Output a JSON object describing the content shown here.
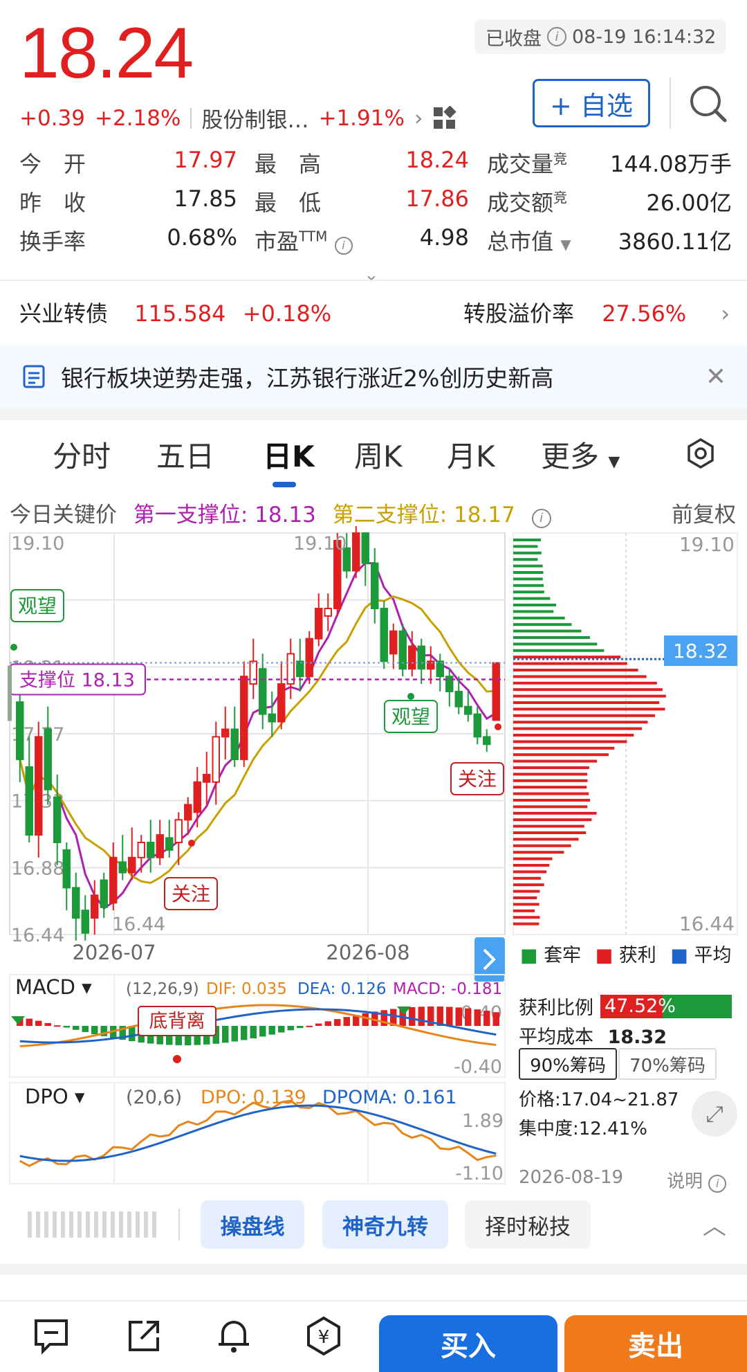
{
  "quote": {
    "price": "18.24",
    "change": "+0.39",
    "change_pct": "+2.18%",
    "sector_name": "股份制银…",
    "sector_pct": "+1.91%",
    "status": "已收盘",
    "datetime": "08-19 16:14:32",
    "fav_label": "+ 自选"
  },
  "stats": {
    "open_label": "今　开",
    "open": "17.97",
    "high_label": "最　高",
    "high": "18.24",
    "volume_label": "成交量",
    "volume_sup": "竞",
    "volume": "144.08万手",
    "prev_label": "昨　收",
    "prev": "17.85",
    "low_label": "最　低",
    "low": "17.86",
    "amount_label": "成交额",
    "amount_sup": "竞",
    "amount": "26.00亿",
    "turnover_label": "换手率",
    "turnover": "0.68%",
    "pe_label": "市盈",
    "pe_sup": "TTM",
    "pe": "4.98",
    "mcap_label": "总市值",
    "mcap": "3860.11亿"
  },
  "bond": {
    "name": "兴业转债",
    "price": "115.584",
    "pct": "+0.18%",
    "premium_label": "转股溢价率",
    "premium": "27.56%"
  },
  "news": {
    "text": "银行板块逆势走强，江苏银行涨近2%创历史新高"
  },
  "tabs": [
    "分时",
    "五日",
    "日K",
    "周K",
    "月K",
    "更多"
  ],
  "active_tab": "日K",
  "key_prices": {
    "label": "今日关键价",
    "support1": "第一支撑位: 18.13",
    "support2": "第二支撑位: 18.17",
    "adjust": "前复权"
  },
  "kchart_labels": {
    "y_ticks": [
      "19.10",
      "18.66",
      "18.21",
      "17.77",
      "17.33",
      "16.88",
      "16.44"
    ],
    "x_ticks": [
      "2026-07",
      "2026-08"
    ],
    "high_mark": "19.10",
    "low_mark": "16.44",
    "support_tag": "支撑位 18.13",
    "watch1": "观望",
    "watch2": "观望",
    "focus1": "关注",
    "focus2": "关注"
  },
  "chips": {
    "top": "19.10",
    "bottom": "16.44",
    "avg_tag": "18.32",
    "legend": [
      "套牢",
      "获利",
      "平均"
    ],
    "profit_label": "获利比例",
    "profit_pct": "47.52%",
    "avg_label": "平均成本",
    "avg_cost": "18.32",
    "btn90": "90%筹码",
    "btn70": "70%筹码",
    "range": "价格:17.04~21.87",
    "concentration": "集中度:12.41%",
    "date": "2026-08-19",
    "explain": "说明"
  },
  "macd": {
    "name": "MACD",
    "params": "(12,26,9)",
    "dif": "DIF: 0.035",
    "dea": "DEA: 0.126",
    "macd": "MACD: -0.181",
    "top": "0.40",
    "bottom": "-0.40",
    "tag": "底背离"
  },
  "dpo": {
    "name": "DPO",
    "params": "(20,6)",
    "dpo": "DPO: 0.139",
    "dpoma": "DPOMA: 0.161",
    "top": "1.89",
    "bottom": "-1.10"
  },
  "tools": [
    "操盘线",
    "神奇九转",
    "择时秘技"
  ],
  "footer": {
    "buy": "买入",
    "sell": "卖出"
  },
  "colors": {
    "up": "#e02020",
    "down": "#1c9a3a",
    "accent": "#1e63c8",
    "ma_purple": "#b020b0",
    "ma_gold": "#c8a000",
    "dif_orange": "#e8851a",
    "dea_blue": "#1e63c8"
  },
  "candles": [
    {
      "o": 17.98,
      "c": 17.6,
      "h": 18.05,
      "l": 17.45
    },
    {
      "o": 17.55,
      "c": 17.1,
      "h": 17.75,
      "l": 17.05
    },
    {
      "o": 17.1,
      "c": 17.75,
      "h": 17.85,
      "l": 16.95
    },
    {
      "o": 17.8,
      "c": 17.4,
      "h": 17.95,
      "l": 17.3
    },
    {
      "o": 17.35,
      "c": 17.05,
      "h": 17.5,
      "l": 16.9
    },
    {
      "o": 17.0,
      "c": 16.75,
      "h": 17.05,
      "l": 16.6
    },
    {
      "o": 16.75,
      "c": 16.55,
      "h": 16.85,
      "l": 16.4
    },
    {
      "o": 16.6,
      "c": 16.45,
      "h": 16.7,
      "l": 16.4
    },
    {
      "o": 16.55,
      "c": 16.7,
      "h": 16.8,
      "l": 16.44
    },
    {
      "o": 16.8,
      "c": 16.62,
      "h": 16.85,
      "l": 16.55
    },
    {
      "o": 16.65,
      "c": 16.95,
      "h": 17.05,
      "l": 16.6
    },
    {
      "o": 16.92,
      "c": 16.85,
      "h": 17.1,
      "l": 16.8
    },
    {
      "o": 16.85,
      "c": 16.95,
      "h": 17.15,
      "l": 16.8
    },
    {
      "o": 16.95,
      "c": 17.05,
      "h": 17.1,
      "l": 16.85
    },
    {
      "o": 17.05,
      "c": 16.95,
      "h": 17.2,
      "l": 16.85
    },
    {
      "o": 16.95,
      "c": 17.1,
      "h": 17.2,
      "l": 16.9
    },
    {
      "o": 17.08,
      "c": 17.0,
      "h": 17.2,
      "l": 16.95
    },
    {
      "o": 17.05,
      "c": 17.2,
      "h": 17.25,
      "l": 16.9
    },
    {
      "o": 17.2,
      "c": 17.3,
      "h": 17.35,
      "l": 17.1
    },
    {
      "o": 17.25,
      "c": 17.45,
      "h": 17.55,
      "l": 17.15
    },
    {
      "o": 17.45,
      "c": 17.5,
      "h": 17.65,
      "l": 17.3
    },
    {
      "o": 17.45,
      "c": 17.75,
      "h": 17.85,
      "l": 17.3
    },
    {
      "o": 17.75,
      "c": 17.8,
      "h": 17.95,
      "l": 17.6
    },
    {
      "o": 17.8,
      "c": 17.6,
      "h": 17.95,
      "l": 17.55
    },
    {
      "o": 17.6,
      "c": 18.15,
      "h": 18.25,
      "l": 17.55
    },
    {
      "o": 18.1,
      "c": 18.25,
      "h": 18.4,
      "l": 18.0
    },
    {
      "o": 18.2,
      "c": 17.9,
      "h": 18.3,
      "l": 17.8
    },
    {
      "o": 17.9,
      "c": 17.85,
      "h": 18.05,
      "l": 17.75
    },
    {
      "o": 17.85,
      "c": 18.1,
      "h": 18.25,
      "l": 17.8
    },
    {
      "o": 18.1,
      "c": 18.3,
      "h": 18.4,
      "l": 18.0
    },
    {
      "o": 18.25,
      "c": 18.15,
      "h": 18.4,
      "l": 18.05
    },
    {
      "o": 18.15,
      "c": 18.4,
      "h": 18.45,
      "l": 18.1
    },
    {
      "o": 18.4,
      "c": 18.6,
      "h": 18.7,
      "l": 18.35
    },
    {
      "o": 18.55,
      "c": 18.6,
      "h": 18.7,
      "l": 18.45
    },
    {
      "o": 18.6,
      "c": 19.05,
      "h": 19.1,
      "l": 18.55
    },
    {
      "o": 19.0,
      "c": 18.85,
      "h": 19.1,
      "l": 18.8
    },
    {
      "o": 18.85,
      "c": 19.1,
      "h": 19.15,
      "l": 18.8
    },
    {
      "o": 19.1,
      "c": 18.9,
      "h": 19.1,
      "l": 18.75
    },
    {
      "o": 18.9,
      "c": 18.6,
      "h": 19.0,
      "l": 18.5
    },
    {
      "o": 18.6,
      "c": 18.25,
      "h": 18.65,
      "l": 18.2
    },
    {
      "o": 18.3,
      "c": 18.45,
      "h": 18.5,
      "l": 18.2
    },
    {
      "o": 18.45,
      "c": 18.2,
      "h": 18.5,
      "l": 18.15
    },
    {
      "o": 18.2,
      "c": 18.35,
      "h": 18.45,
      "l": 18.15
    },
    {
      "o": 18.35,
      "c": 18.2,
      "h": 18.4,
      "l": 18.1
    },
    {
      "o": 18.2,
      "c": 18.25,
      "h": 18.35,
      "l": 18.1
    },
    {
      "o": 18.25,
      "c": 18.15,
      "h": 18.3,
      "l": 18.05
    },
    {
      "o": 18.15,
      "c": 18.05,
      "h": 18.2,
      "l": 17.95
    },
    {
      "o": 18.05,
      "c": 17.95,
      "h": 18.15,
      "l": 17.9
    },
    {
      "o": 17.95,
      "c": 17.9,
      "h": 18.05,
      "l": 17.85
    },
    {
      "o": 17.9,
      "c": 17.75,
      "h": 17.95,
      "l": 17.7
    },
    {
      "o": 17.75,
      "c": 17.7,
      "h": 17.8,
      "l": 17.65
    },
    {
      "o": 17.86,
      "c": 18.24,
      "h": 18.24,
      "l": 17.86
    }
  ]
}
